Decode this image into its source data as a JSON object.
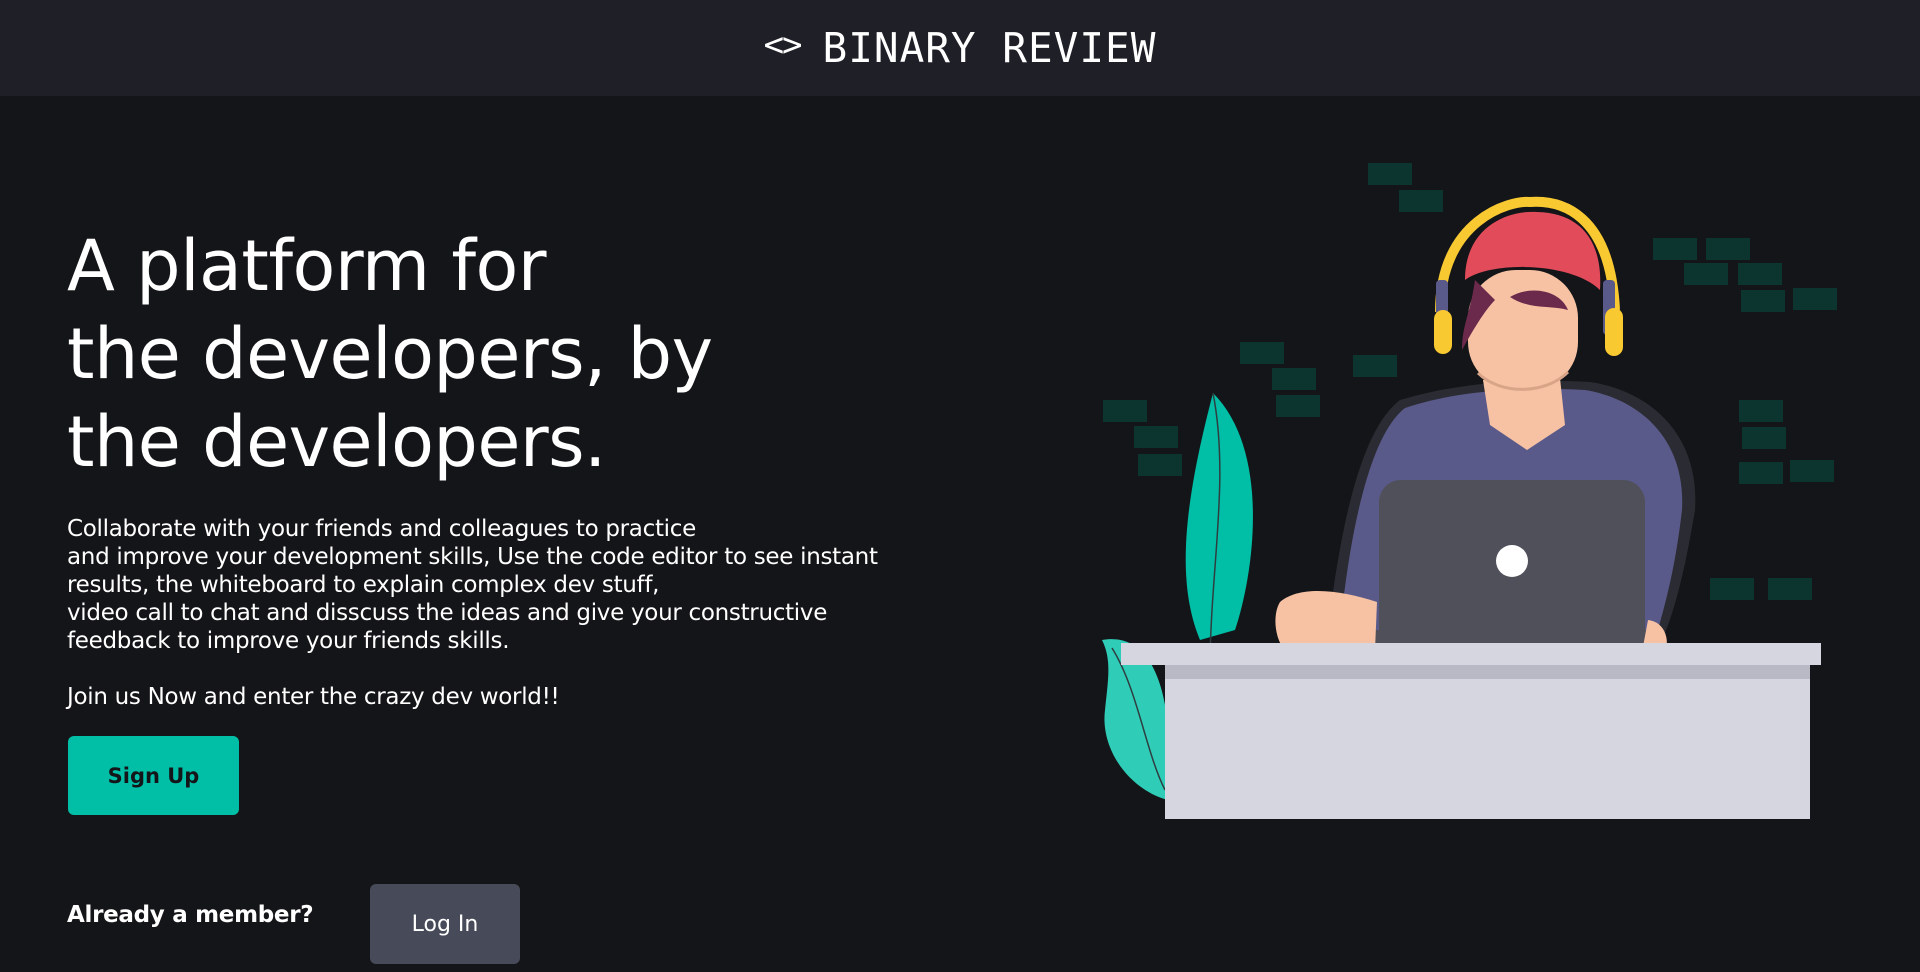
{
  "header": {
    "brand_icon": "<>",
    "brand_name": "BINARY REVIEW"
  },
  "hero": {
    "title_lines": [
      "A platform for",
      "the developers, by",
      "the developers."
    ],
    "description_lines": [
      "Collaborate with your friends and colleagues to practice",
      "and improve your development skills, Use the code editor to see instant",
      "results, the whiteboard to explain complex dev stuff,",
      "video call to chat and disscuss the ideas and give your constructive",
      "feedback to improve your friends skills."
    ],
    "join_text": "Join us Now and enter the crazy dev world!!",
    "signup_label": "Sign Up"
  },
  "login": {
    "member_label": "Already a member?",
    "login_label": "Log In"
  },
  "illustration": {
    "name": "developer-at-desk-illustration",
    "colors": {
      "accent": "#00bfa6",
      "cap": "#e14b5a",
      "headphones": "#f9c932",
      "shirt": "#5a5a8a",
      "skin": "#f6c2a3",
      "laptop": "#4f5059",
      "desk": "#d6d6e0",
      "code_blocks": "#0d3530"
    }
  }
}
